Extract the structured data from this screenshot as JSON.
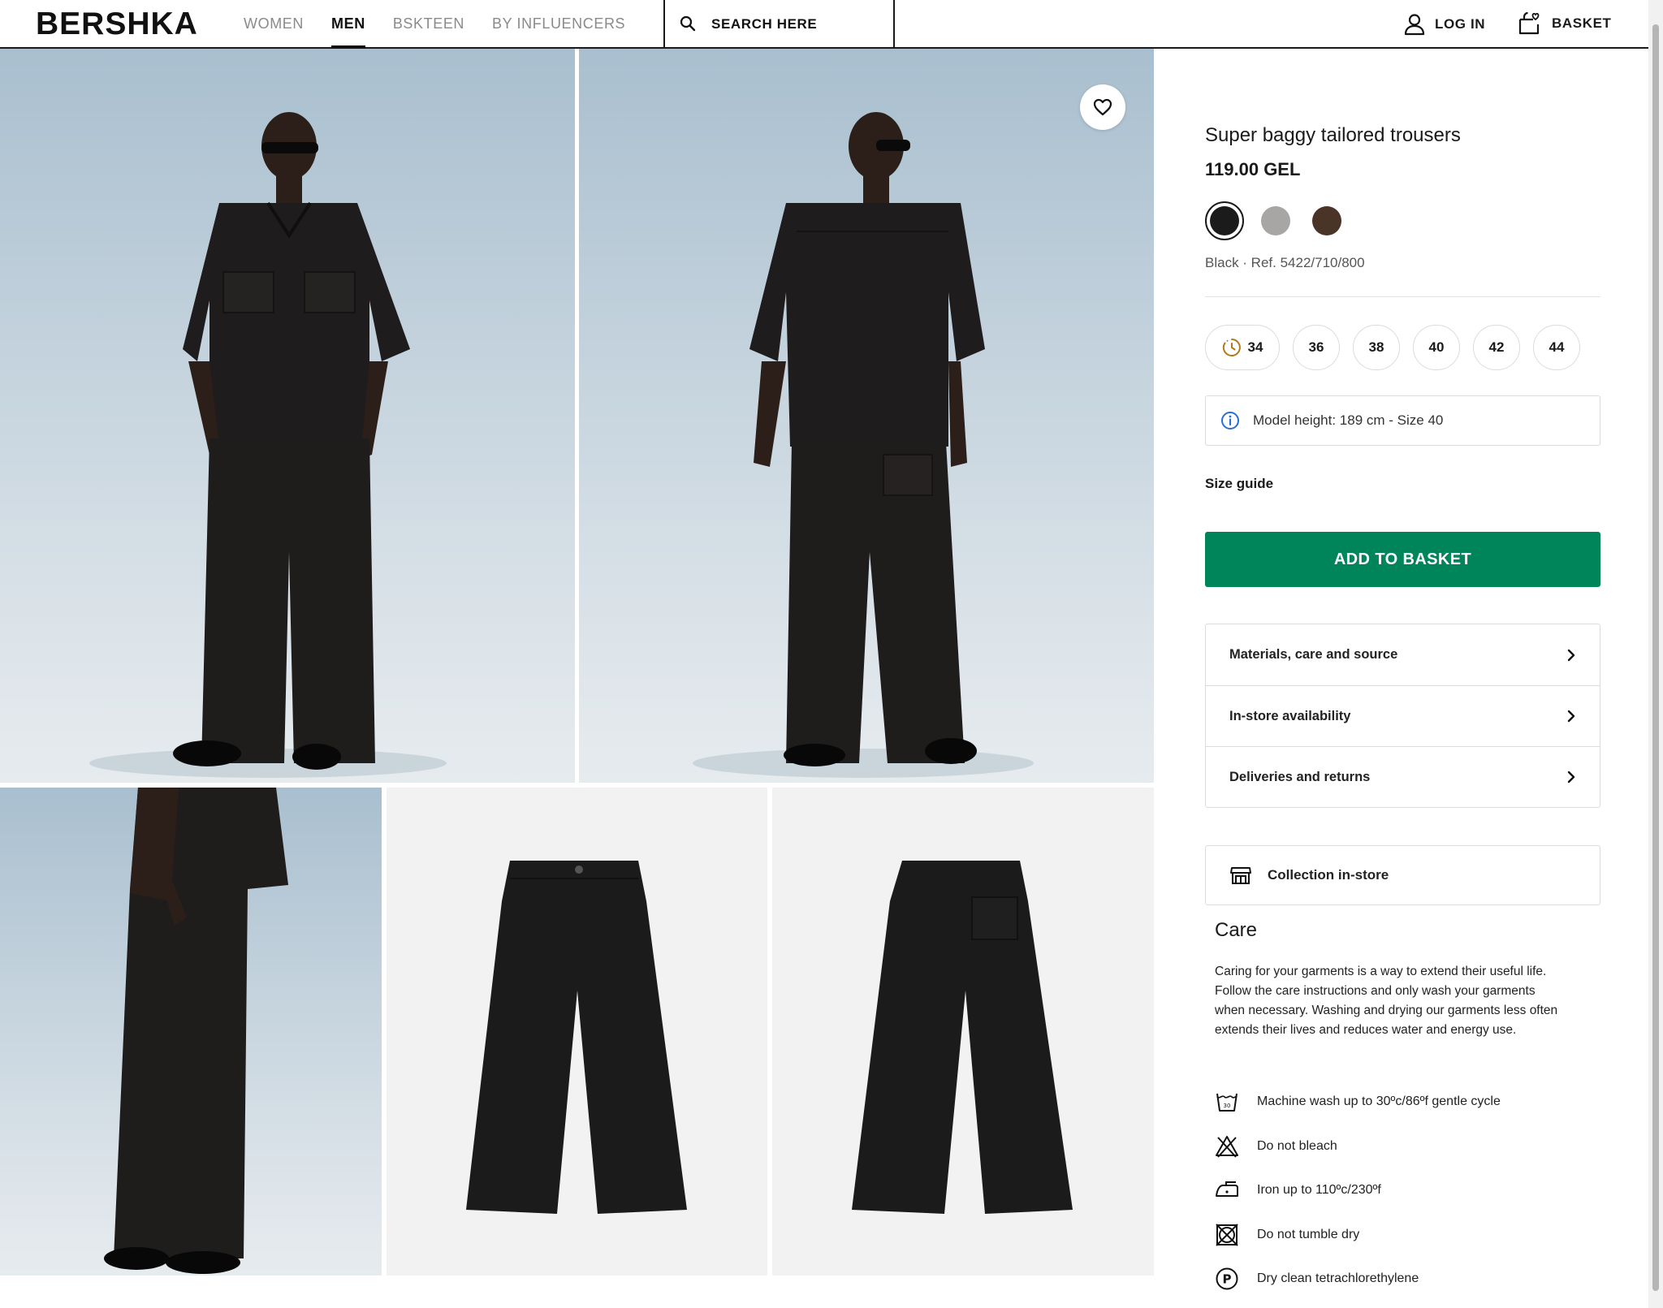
{
  "header": {
    "logo": "BERSHKA",
    "nav": [
      {
        "label": "WOMEN",
        "active": false
      },
      {
        "label": "MEN",
        "active": true
      },
      {
        "label": "BSKTEEN",
        "active": false
      },
      {
        "label": "BY INFLUENCERS",
        "active": false
      }
    ],
    "search_label": "SEARCH HERE",
    "login_label": "LOG IN",
    "basket_label": "BASKET"
  },
  "product": {
    "title": "Super baggy tailored trousers",
    "price": "119.00 GEL",
    "colors": [
      {
        "hex": "#1b1b1b",
        "selected": true
      },
      {
        "hex": "#a7a6a5",
        "selected": false
      },
      {
        "hex": "#4a3327",
        "selected": false
      }
    ],
    "ref": "Black · Ref. 5422/710/800",
    "sizes": [
      "34",
      "36",
      "38",
      "40",
      "42",
      "44"
    ],
    "model_info": "Model height: 189 cm - Size 40",
    "size_guide": "Size guide",
    "add_button": "ADD TO BASKET",
    "accordion": [
      "Materials, care and source",
      "In-store availability",
      "Deliveries and returns"
    ],
    "collection": "Collection in-store"
  },
  "care": {
    "heading": "Care",
    "text": "Caring for your garments is a way to extend their useful life. Follow the care instructions and only wash your garments when necessary. Washing and drying our garments less often extends their lives and reduces water and energy use.",
    "items": [
      {
        "icon": "wash-30-icon",
        "label": "Machine wash up to 30ºc/86ºf gentle cycle"
      },
      {
        "icon": "no-bleach-icon",
        "label": "Do not bleach"
      },
      {
        "icon": "iron-icon",
        "label": "Iron up to 110ºc/230ºf"
      },
      {
        "icon": "no-tumble-dry-icon",
        "label": "Do not tumble dry"
      },
      {
        "icon": "dry-clean-p-icon",
        "label": "Dry clean tetrachlorethylene"
      }
    ]
  },
  "colors": {
    "accent_green": "#00855a"
  }
}
